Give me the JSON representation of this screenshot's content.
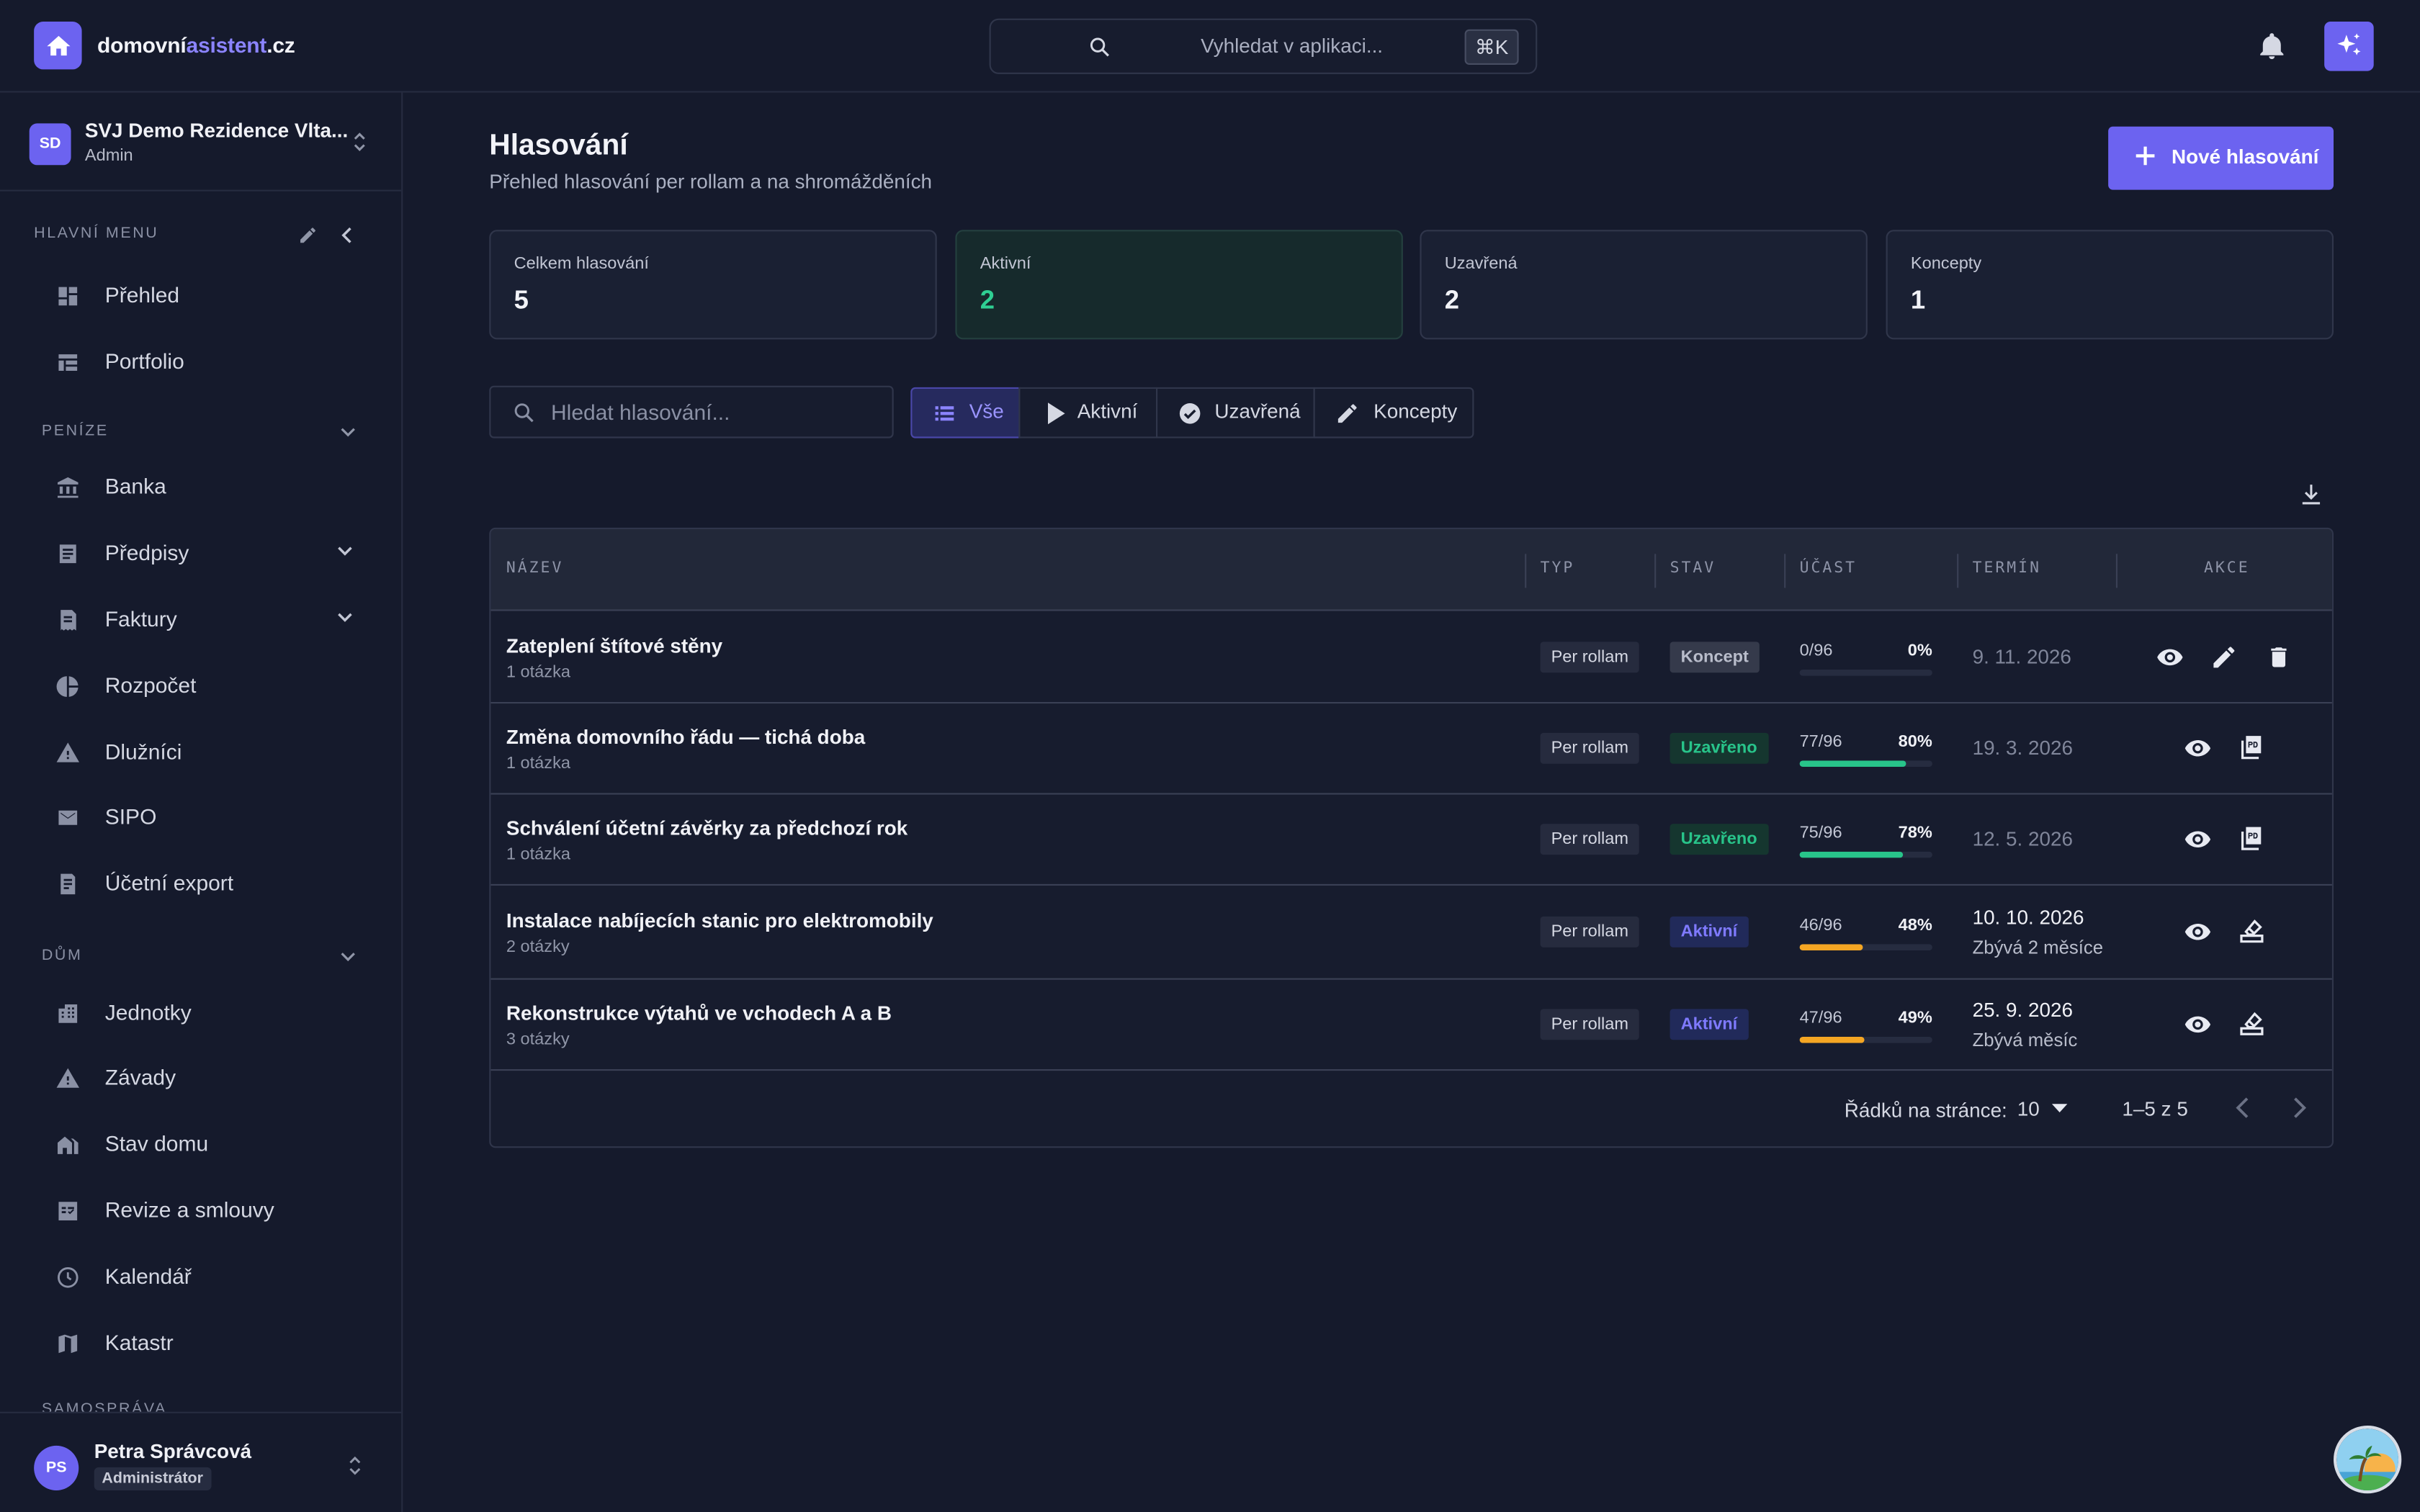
{
  "brand": {
    "part1": "domovní",
    "part2": "asistent",
    "part3": ".cz"
  },
  "topbar": {
    "search_placeholder": "Vyhledat v aplikaci...",
    "shortcut": "⌘K"
  },
  "org": {
    "initials": "SD",
    "name": "SVJ Demo Rezidence Vlta...",
    "role": "Admin"
  },
  "sidebar": {
    "main_label": "HLAVNÍ MENU",
    "money_label": "PENÍZE",
    "house_label": "DŮM",
    "gov_label": "SAMOSPRÁVA",
    "items": [
      {
        "label": "Přehled",
        "icon": "dashboard-icon"
      },
      {
        "label": "Portfolio",
        "icon": "portfolio-icon"
      },
      {
        "label": "Banka",
        "icon": "bank-icon"
      },
      {
        "label": "Předpisy",
        "icon": "document-icon"
      },
      {
        "label": "Faktury",
        "icon": "invoice-icon"
      },
      {
        "label": "Rozpočet",
        "icon": "pie-icon"
      },
      {
        "label": "Dlužníci",
        "icon": "warning-icon"
      },
      {
        "label": "SIPO",
        "icon": "mail-icon"
      },
      {
        "label": "Účetní export",
        "icon": "export-icon"
      },
      {
        "label": "Jednotky",
        "icon": "building-icon"
      },
      {
        "label": "Závady",
        "icon": "warning-icon"
      },
      {
        "label": "Stav domu",
        "icon": "house-icon"
      },
      {
        "label": "Revize a smlouvy",
        "icon": "contract-icon"
      },
      {
        "label": "Kalendář",
        "icon": "clock-icon"
      },
      {
        "label": "Katastr",
        "icon": "map-icon"
      }
    ]
  },
  "user": {
    "initials": "PS",
    "name": "Petra Správcová",
    "role": "Administrátor"
  },
  "page": {
    "title": "Hlasování",
    "subtitle": "Přehled hlasování per rollam a na shromážděních",
    "new_button": "Nové hlasování"
  },
  "stats": [
    {
      "label": "Celkem hlasování",
      "value": "5"
    },
    {
      "label": "Aktivní",
      "value": "2"
    },
    {
      "label": "Uzavřená",
      "value": "2"
    },
    {
      "label": "Koncepty",
      "value": "1"
    }
  ],
  "filters": {
    "search_placeholder": "Hledat hlasování...",
    "segments": [
      "Vše",
      "Aktivní",
      "Uzavřená",
      "Koncepty"
    ],
    "active": "Vše"
  },
  "table": {
    "headers": [
      "NÁZEV",
      "TYP",
      "STAV",
      "ÚČAST",
      "TERMÍN",
      "AKCE"
    ],
    "rows": [
      {
        "title": "Zateplení štítové stěny",
        "sub": "1 otázka",
        "type": "Per rollam",
        "status": "Koncept",
        "count": "0/96",
        "pct": "0%",
        "fill": 0,
        "date": "9. 11. 2026",
        "remaining": ""
      },
      {
        "title": "Změna domovního řádu — tichá doba",
        "sub": "1 otázka",
        "type": "Per rollam",
        "status": "Uzavřeno",
        "count": "77/96",
        "pct": "80%",
        "fill": 0.8,
        "date": "19. 3. 2026",
        "remaining": ""
      },
      {
        "title": "Schválení účetní závěrky za předchozí rok",
        "sub": "1 otázka",
        "type": "Per rollam",
        "status": "Uzavřeno",
        "count": "75/96",
        "pct": "78%",
        "fill": 0.78,
        "date": "12. 5. 2026",
        "remaining": ""
      },
      {
        "title": "Instalace nabíjecích stanic pro elektromobily",
        "sub": "2 otázky",
        "type": "Per rollam",
        "status": "Aktivní",
        "count": "46/96",
        "pct": "48%",
        "fill": 0.48,
        "date": "10. 10. 2026",
        "remaining": "Zbývá 2 měsíce"
      },
      {
        "title": "Rekonstrukce výtahů ve vchodech A a B",
        "sub": "3 otázky",
        "type": "Per rollam",
        "status": "Aktivní",
        "count": "47/96",
        "pct": "49%",
        "fill": 0.49,
        "date": "25. 9. 2026",
        "remaining": "Zbývá měsíc"
      }
    ]
  },
  "pager": {
    "rows_label": "Řádků na stránce:",
    "rows_value": "10",
    "range": "1–5 z 5"
  },
  "colors": {
    "accent": "#6c63f0",
    "success": "#28c48a",
    "warning": "#f5a623"
  }
}
